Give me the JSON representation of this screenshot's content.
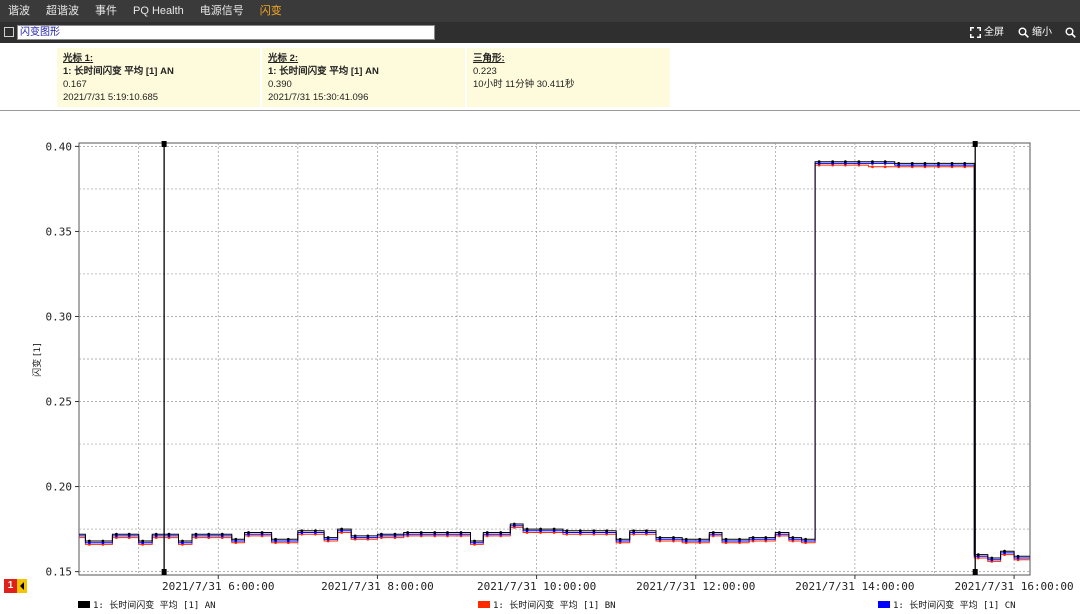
{
  "tabs": [
    {
      "label": "谐波",
      "active": false
    },
    {
      "label": "超谐波",
      "active": false
    },
    {
      "label": "事件",
      "active": false
    },
    {
      "label": "PQ Health",
      "active": false
    },
    {
      "label": "电源信号",
      "active": false
    },
    {
      "label": "闪变",
      "active": true
    }
  ],
  "toolbar": {
    "title_value": "闪变图形",
    "fullscreen_label": "全屏",
    "zoomout_label": "缩小"
  },
  "cursors": {
    "cursor1": {
      "header": "光标 1:",
      "series": "1: 长时间闪变 平均 [1] AN",
      "value": "0.167",
      "time": "2021/7/31 5:19:10.685"
    },
    "cursor2": {
      "header": "光标 2:",
      "series": "1: 长时间闪变 平均 [1] AN",
      "value": "0.390",
      "time": "2021/7/31 15:30:41.096"
    },
    "delta": {
      "header": "三角形:",
      "value": "0.223",
      "duration": "10小时 11分钟 30.411秒"
    }
  },
  "page_badge": "1",
  "colors": {
    "an": "#000000",
    "bn": "#ff2a00",
    "cn": "#0000ff",
    "accent": "#f5a623"
  },
  "chart_data": {
    "type": "line",
    "ylabel": "闪变 [1]",
    "ylim": [
      0.148,
      0.402
    ],
    "xlim_hours": [
      4.25,
      16.2
    ],
    "y_ticks": [
      "0.15",
      "0.20",
      "0.25",
      "0.30",
      "0.35",
      "0.40"
    ],
    "x_ticks": [
      "2021/7/31 6:00:00",
      "2021/7/31 8:00:00",
      "2021/7/31 10:00:00",
      "2021/7/31 12:00:00",
      "2021/7/31 14:00:00",
      "2021/7/31 16:00:00"
    ],
    "x_tick_hours": [
      6,
      8,
      10,
      12,
      14,
      16
    ],
    "cursor_hours": [
      5.3196,
      15.5114
    ],
    "series": [
      {
        "name": "1: 长时间闪变 平均 [1] AN",
        "color": "#000000",
        "x": [
          4.2,
          4.33,
          4.5,
          4.67,
          4.83,
          5.0,
          5.17,
          5.33,
          5.5,
          5.67,
          5.83,
          6.0,
          6.17,
          6.33,
          6.5,
          6.67,
          6.83,
          7.0,
          7.17,
          7.33,
          7.5,
          7.67,
          7.83,
          8.0,
          8.17,
          8.33,
          8.5,
          8.67,
          8.83,
          9.0,
          9.17,
          9.33,
          9.5,
          9.67,
          9.83,
          10.0,
          10.17,
          10.33,
          10.5,
          10.67,
          10.83,
          11.0,
          11.17,
          11.33,
          11.5,
          11.67,
          11.83,
          12.0,
          12.17,
          12.33,
          12.5,
          12.67,
          12.83,
          13.0,
          13.17,
          13.33,
          13.5,
          13.67,
          13.83,
          14.0,
          14.17,
          14.33,
          14.5,
          14.67,
          14.83,
          15.0,
          15.17,
          15.33,
          15.5,
          15.67,
          15.83,
          16.0
        ],
        "y": [
          0.172,
          0.168,
          0.168,
          0.172,
          0.172,
          0.168,
          0.172,
          0.172,
          0.168,
          0.172,
          0.172,
          0.172,
          0.169,
          0.173,
          0.173,
          0.169,
          0.169,
          0.174,
          0.174,
          0.17,
          0.175,
          0.171,
          0.171,
          0.172,
          0.172,
          0.173,
          0.173,
          0.173,
          0.173,
          0.173,
          0.168,
          0.173,
          0.173,
          0.178,
          0.175,
          0.175,
          0.175,
          0.174,
          0.174,
          0.174,
          0.174,
          0.169,
          0.174,
          0.174,
          0.17,
          0.17,
          0.169,
          0.169,
          0.173,
          0.169,
          0.169,
          0.17,
          0.17,
          0.173,
          0.17,
          0.169,
          0.391,
          0.391,
          0.391,
          0.391,
          0.391,
          0.391,
          0.39,
          0.39,
          0.39,
          0.39,
          0.39,
          0.39,
          0.16,
          0.158,
          0.162,
          0.159
        ]
      },
      {
        "name": "1: 长时间闪变 平均 [1] BN",
        "color": "#ff2a00",
        "x": [
          4.2,
          4.33,
          4.5,
          4.67,
          4.83,
          5.0,
          5.17,
          5.33,
          5.5,
          5.67,
          5.83,
          6.0,
          6.17,
          6.33,
          6.5,
          6.67,
          6.83,
          7.0,
          7.17,
          7.33,
          7.5,
          7.67,
          7.83,
          8.0,
          8.17,
          8.33,
          8.5,
          8.67,
          8.83,
          9.0,
          9.17,
          9.33,
          9.5,
          9.67,
          9.83,
          10.0,
          10.17,
          10.33,
          10.5,
          10.67,
          10.83,
          11.0,
          11.17,
          11.33,
          11.5,
          11.67,
          11.83,
          12.0,
          12.17,
          12.33,
          12.5,
          12.67,
          12.83,
          13.0,
          13.17,
          13.33,
          13.5,
          13.67,
          13.83,
          14.0,
          14.17,
          14.33,
          14.5,
          14.67,
          14.83,
          15.0,
          15.17,
          15.33,
          15.5,
          15.67,
          15.83,
          16.0
        ],
        "y": [
          0.17,
          0.166,
          0.166,
          0.17,
          0.17,
          0.166,
          0.17,
          0.17,
          0.166,
          0.17,
          0.17,
          0.17,
          0.167,
          0.171,
          0.171,
          0.167,
          0.167,
          0.172,
          0.172,
          0.168,
          0.173,
          0.169,
          0.169,
          0.17,
          0.17,
          0.171,
          0.171,
          0.171,
          0.171,
          0.171,
          0.166,
          0.171,
          0.171,
          0.176,
          0.173,
          0.173,
          0.173,
          0.172,
          0.172,
          0.172,
          0.172,
          0.167,
          0.172,
          0.172,
          0.168,
          0.168,
          0.167,
          0.167,
          0.171,
          0.167,
          0.167,
          0.168,
          0.168,
          0.171,
          0.168,
          0.167,
          0.389,
          0.389,
          0.389,
          0.389,
          0.388,
          0.388,
          0.388,
          0.388,
          0.388,
          0.388,
          0.388,
          0.388,
          0.158,
          0.156,
          0.16,
          0.157
        ]
      },
      {
        "name": "1: 长时间闪变 平均 [1] CN",
        "color": "#0000ff",
        "x": [
          4.2,
          4.33,
          4.5,
          4.67,
          4.83,
          5.0,
          5.17,
          5.33,
          5.5,
          5.67,
          5.83,
          6.0,
          6.17,
          6.33,
          6.5,
          6.67,
          6.83,
          7.0,
          7.17,
          7.33,
          7.5,
          7.67,
          7.83,
          8.0,
          8.17,
          8.33,
          8.5,
          8.67,
          8.83,
          9.0,
          9.17,
          9.33,
          9.5,
          9.67,
          9.83,
          10.0,
          10.17,
          10.33,
          10.5,
          10.67,
          10.83,
          11.0,
          11.17,
          11.33,
          11.5,
          11.67,
          11.83,
          12.0,
          12.17,
          12.33,
          12.5,
          12.67,
          12.83,
          13.0,
          13.17,
          13.33,
          13.5,
          13.67,
          13.83,
          14.0,
          14.17,
          14.33,
          14.5,
          14.67,
          14.83,
          15.0,
          15.17,
          15.33,
          15.5,
          15.67,
          15.83,
          16.0
        ],
        "y": [
          0.171,
          0.167,
          0.167,
          0.171,
          0.171,
          0.167,
          0.171,
          0.171,
          0.167,
          0.171,
          0.171,
          0.171,
          0.168,
          0.172,
          0.172,
          0.168,
          0.168,
          0.173,
          0.173,
          0.169,
          0.174,
          0.17,
          0.17,
          0.171,
          0.171,
          0.172,
          0.172,
          0.172,
          0.172,
          0.172,
          0.167,
          0.172,
          0.172,
          0.177,
          0.174,
          0.174,
          0.174,
          0.173,
          0.173,
          0.173,
          0.173,
          0.168,
          0.173,
          0.173,
          0.169,
          0.169,
          0.168,
          0.168,
          0.172,
          0.168,
          0.168,
          0.169,
          0.169,
          0.172,
          0.169,
          0.168,
          0.39,
          0.39,
          0.39,
          0.39,
          0.39,
          0.39,
          0.389,
          0.389,
          0.389,
          0.389,
          0.389,
          0.389,
          0.159,
          0.157,
          0.161,
          0.158
        ]
      }
    ]
  }
}
